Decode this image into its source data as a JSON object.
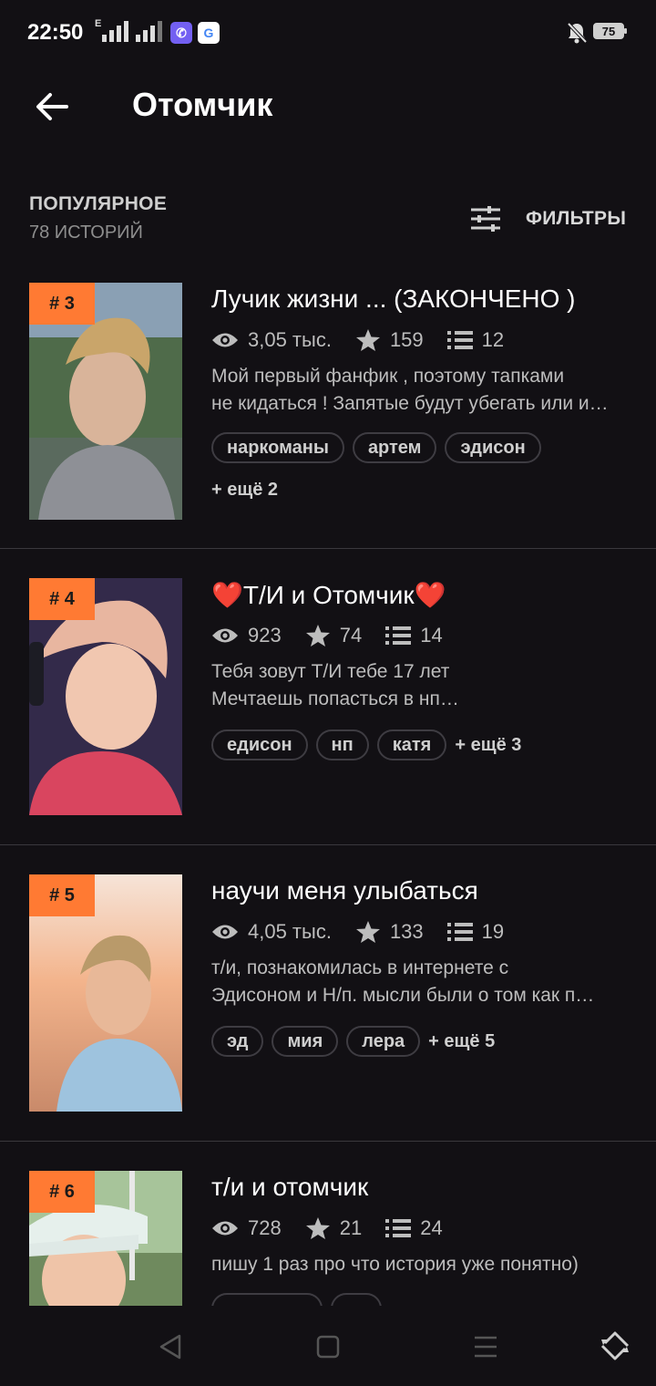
{
  "status": {
    "time": "22:50",
    "network_type": "E",
    "battery": "75"
  },
  "header": {
    "title": "Отомчик"
  },
  "section": {
    "title": "ПОПУЛЯРНОЕ",
    "count": "78 ИСТОРИЙ",
    "filter_label": "ФИЛЬТРЫ"
  },
  "stories": [
    {
      "rank": "# 3",
      "title": "Лучик жизни ...  (ЗАКОНЧЕНО )",
      "views": "3,05 тыс.",
      "votes": "159",
      "parts": "12",
      "desc_line1": "Мой первый фанфик , поэтому тапками",
      "desc_line2": "не кидаться ! Запятые будут убегать или и…",
      "tags": [
        "наркоманы",
        "артем",
        "эдисон"
      ],
      "more": "+ ещё 2"
    },
    {
      "rank": "# 4",
      "title": "❤️Т/И и Отомчик❤️",
      "views": "923",
      "votes": "74",
      "parts": "14",
      "desc_line1": "Тебя зовут Т/И тебе 17 лет",
      "desc_line2": "Мечтаешь попасться в нп…",
      "tags": [
        "едисон",
        "нп",
        "катя"
      ],
      "more": "+ ещё 3"
    },
    {
      "rank": "# 5",
      "title": "научи меня улыбаться",
      "views": "4,05 тыс.",
      "votes": "133",
      "parts": "19",
      "desc_line1": "т/и, познакомилась в интернете с",
      "desc_line2": "Эдисоном и Н/п. мысли были о том как п…",
      "tags": [
        "эд",
        "мия",
        "лера"
      ],
      "more": "+ ещё 5"
    },
    {
      "rank": "# 6",
      "title": "т/и и отомчик",
      "views": "728",
      "votes": "21",
      "parts": "24",
      "desc_line1": "пишу 1 раз про что история уже понятно)",
      "desc_line2": "",
      "tags": [],
      "more": ""
    }
  ],
  "colors": {
    "background": "#121014",
    "accent": "#ff7a33",
    "muted_text": "#bdbdbd"
  },
  "icons": [
    "back-arrow-icon",
    "filter-sliders-icon",
    "eye-icon",
    "star-icon",
    "list-icon",
    "triangle-back-icon",
    "square-home-icon",
    "menu-lines-icon",
    "rotate-icon"
  ]
}
